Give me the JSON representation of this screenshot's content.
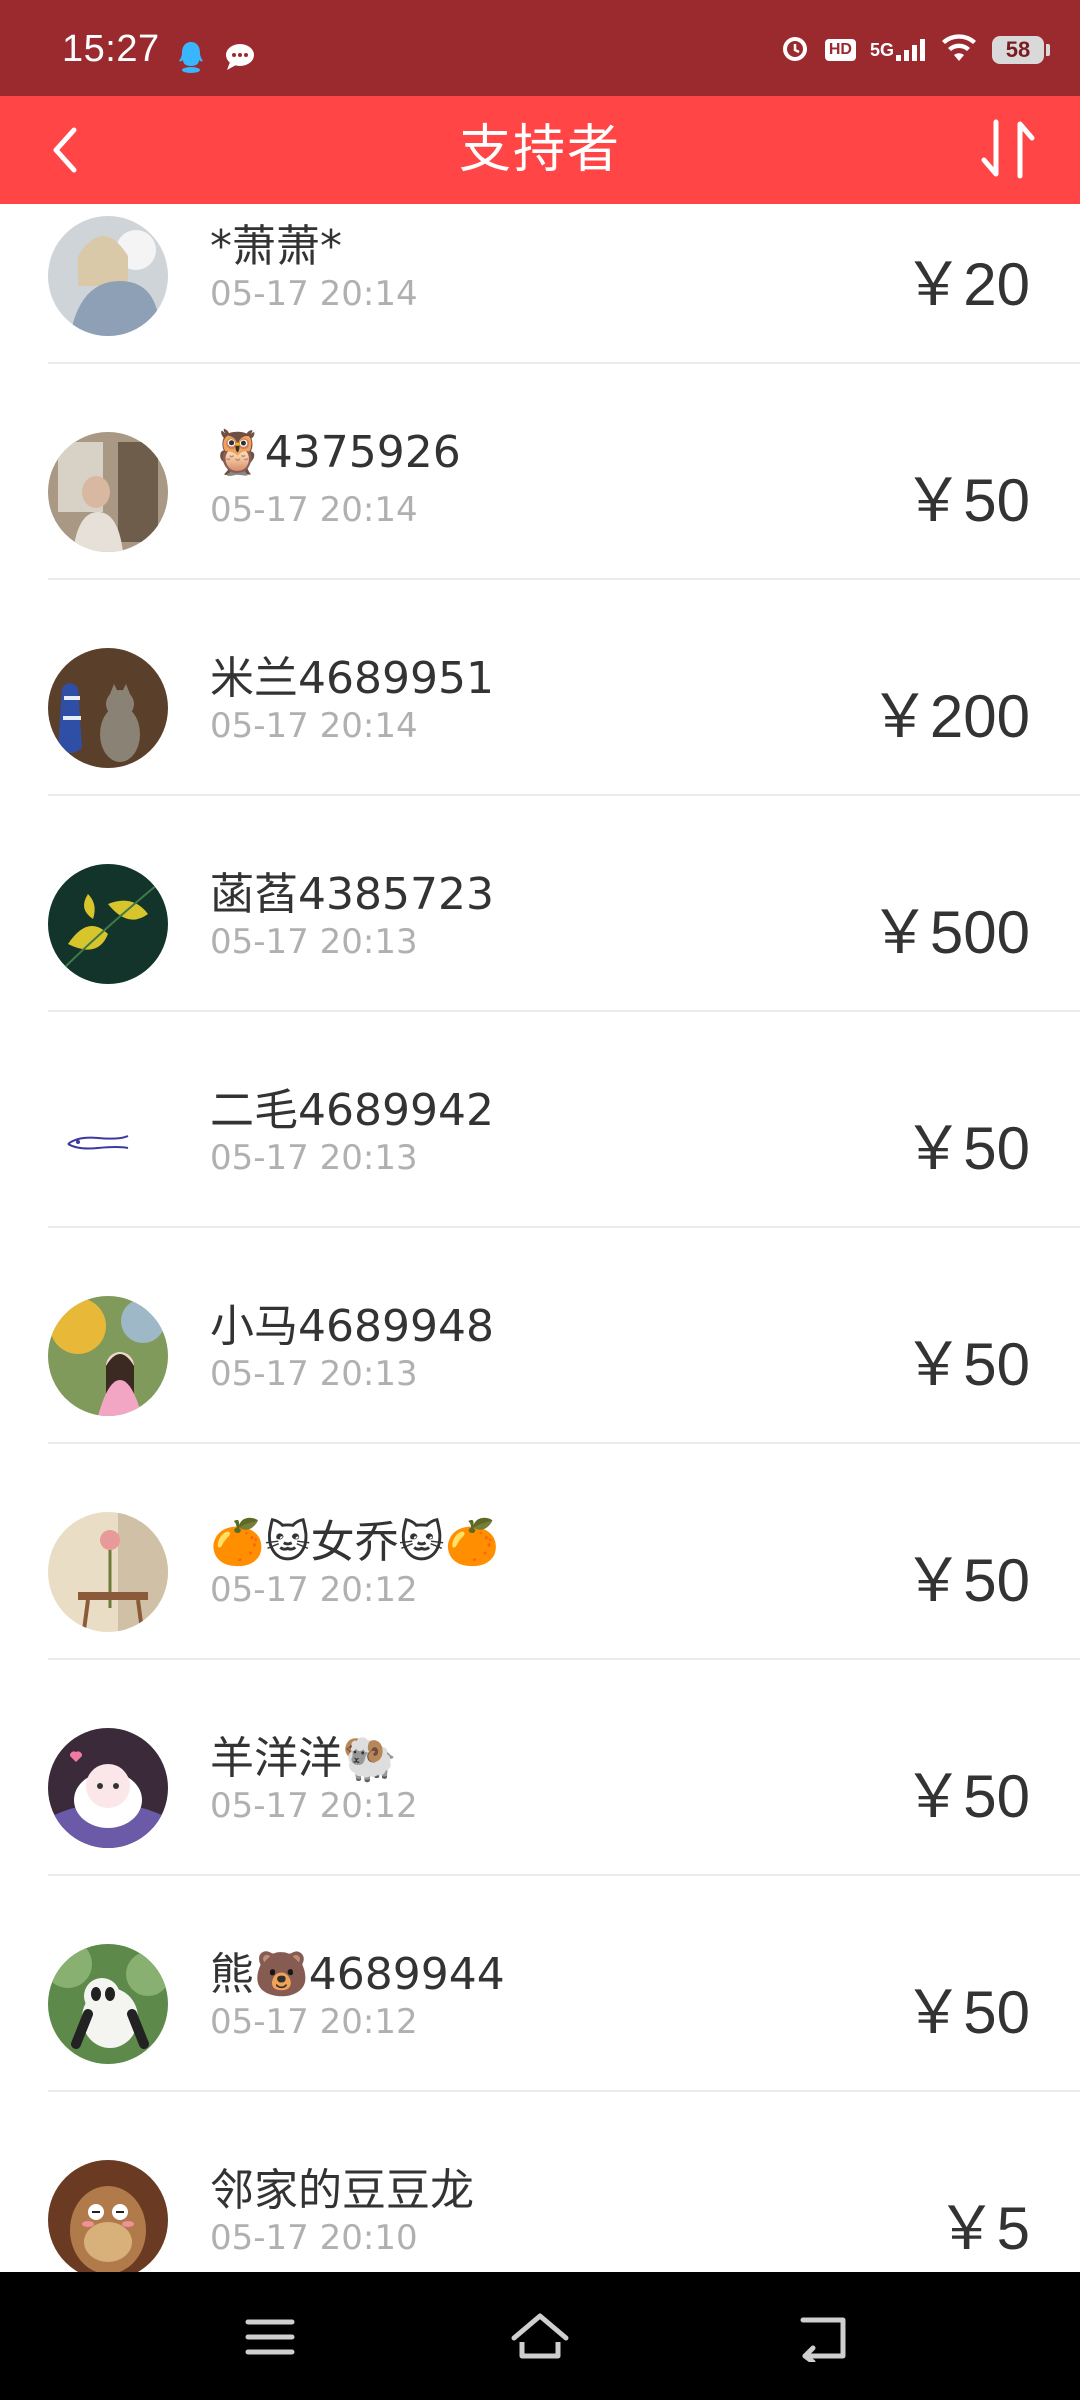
{
  "status_bar": {
    "time": "15:27",
    "network": "5G",
    "hd": "HD",
    "battery": "58"
  },
  "header": {
    "title": "支持者"
  },
  "supporters": [
    {
      "name": "*萧萧*",
      "time": "05-17 20:14",
      "amount": "￥20"
    },
    {
      "name": "🦉4375926",
      "time": "05-17 20:14",
      "amount": "￥50"
    },
    {
      "name": "米兰4689951",
      "time": "05-17 20:14",
      "amount": "￥200"
    },
    {
      "name": "菡萏4385723",
      "time": "05-17 20:13",
      "amount": "￥500"
    },
    {
      "name": "二毛4689942",
      "time": "05-17 20:13",
      "amount": "￥50"
    },
    {
      "name": "小马4689948",
      "time": "05-17 20:13",
      "amount": "￥50"
    },
    {
      "name": "🍊🐱女乔🐱🍊",
      "time": "05-17 20:12",
      "amount": "￥50"
    },
    {
      "name": "羊洋洋🐏",
      "time": "05-17 20:12",
      "amount": "￥50"
    },
    {
      "name": "熊🐻4689944",
      "time": "05-17 20:12",
      "amount": "￥50"
    },
    {
      "name": "邻家的豆豆龙",
      "time": "05-17 20:10",
      "amount": "￥5"
    }
  ],
  "colors": {
    "status_bar": "#9b2a2f",
    "header": "#ff4545",
    "text": "#333333",
    "muted": "#b0b0b0"
  }
}
